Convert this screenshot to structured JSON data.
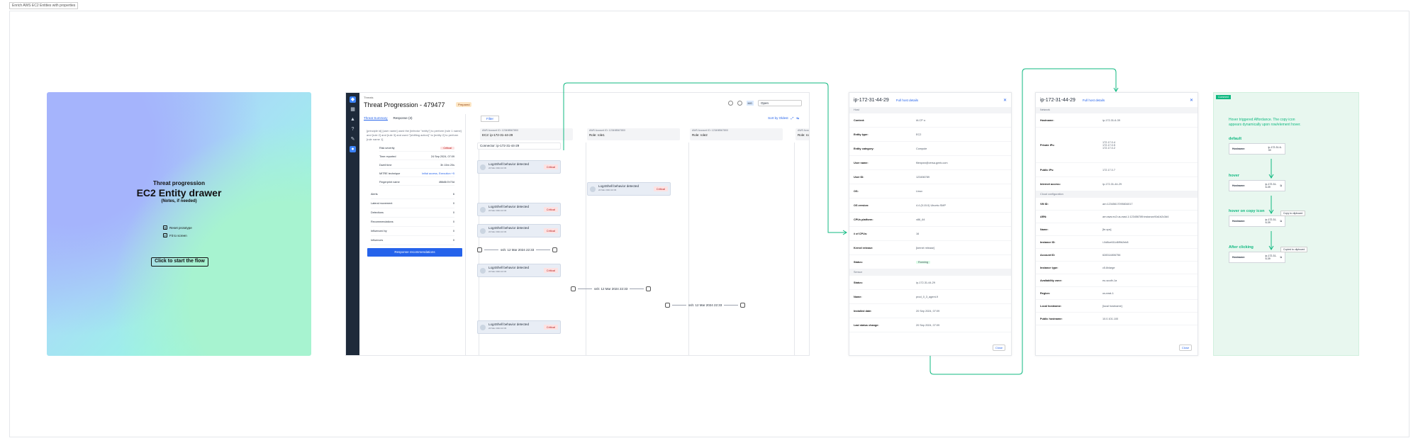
{
  "frame_label": "Enrich AWS EC2 Entities with properties",
  "hero": {
    "title_small": "Threat progression",
    "title_big": "EC2 Entity drawer",
    "title_sub": "(Notes, if needed)",
    "option1": "Reset prototype",
    "option1_key": "R",
    "option2": "Fit to screen",
    "option2_key": "F",
    "start_button": "Click to start the flow"
  },
  "app": {
    "breadcrumb": "Threats",
    "title": "Threat Progression - 479477",
    "status_badge": "Prepared",
    "status_select": "Open",
    "avatar_initials": "MG",
    "tabs": [
      "Threat Summary",
      "Response (3)"
    ],
    "description": "[principle id] [user name] used the [infector \"entity\"] to perform [rule 1 name] and [rule 2] and [rule 3] and used \"[shifting action]\" to [entity 2] to perform [rule name 1]",
    "fields": [
      {
        "k": "Risk severity",
        "v": "Critical",
        "type": "crit"
      },
      {
        "k": "Time reported",
        "v": "24 Sep 2024, 07:09"
      },
      {
        "k": "Dwell time",
        "v": "3h 15m 20s"
      },
      {
        "k": "MITRE technique",
        "v": "Initial access, Execution +5",
        "type": "link"
      },
      {
        "k": "Fingerprint name",
        "v": "4f6b8b7e70d"
      }
    ],
    "counts": [
      {
        "k": "Alerts",
        "v": "6"
      },
      {
        "k": "Lateral movement",
        "v": "0"
      },
      {
        "k": "Detections",
        "v": "0"
      },
      {
        "k": "Recommendations",
        "v": "0"
      },
      {
        "k": "Influenced by",
        "v": "0"
      },
      {
        "k": "Influences",
        "v": "0"
      }
    ],
    "response_button": "Response recommendations",
    "filter_button": "Filter",
    "sort_label": "Sort by Oldest",
    "lanes": [
      {
        "acct": "AWS Account ID: 123498567800",
        "name": "EC2: ip-172-31-44-29"
      },
      {
        "acct": "AWS Account ID: 123498567800",
        "name": "Role: role1"
      },
      {
        "acct": "AWS Account ID: 123498567800",
        "name": "Role: role2"
      },
      {
        "acct": "AWS Account ID: 123498567800",
        "name": "Role: role3"
      }
    ],
    "connector": "Connector: ip-172-31-44-29",
    "event_title": "Log4Shell behavior detected",
    "event_time": "24 Mar 2024 22:33",
    "event_sev": "Critical",
    "switch_label": "ssh: 12 Mar 2024 22:33"
  },
  "drawer1": {
    "title": "ip-172-31-44-29",
    "full_link": "Full host details",
    "close_button": "Close",
    "section1": "Host",
    "rows": [
      {
        "k": "Context:",
        "v": "IA CP ••"
      },
      {
        "k": "Entity type:",
        "v": "EC2"
      },
      {
        "k": "Entity category:",
        "v": "Compute"
      },
      {
        "k": "User name:",
        "v": "filenpwn@versa.geek.com"
      },
      {
        "k": "User ID:",
        "v": "123456789"
      },
      {
        "k": "OS:",
        "v": "Linux"
      },
      {
        "k": "OS version:",
        "v": "4.4 (5.15.0) Ubuntu SMP"
      },
      {
        "k": "CPUs platform:",
        "v": "x86_64"
      },
      {
        "k": "# of CPUs:",
        "v": "16"
      },
      {
        "k": "Kernel release:",
        "v": "[kernel release]"
      },
      {
        "k": "Status:",
        "v": "Running"
      }
    ],
    "section2": "Sensor",
    "rows2": [
      {
        "k": "Status:",
        "v": "ip-172-31-44-29"
      },
      {
        "k": "Name:",
        "v": "prod_0_3_agent-9"
      },
      {
        "k": "Installed date:",
        "v": "20 Sep 2024, 07:09"
      },
      {
        "k": "Last status change:",
        "v": "20 Sep 2024, 07:09"
      }
    ]
  },
  "drawer2": {
    "title": "ip-172-31-44-29",
    "full_link": "Full host details",
    "close_button": "Close",
    "section1": "Network",
    "rows": [
      {
        "k": "Hostname:",
        "v": "ip-172-31-6-39"
      },
      {
        "k": "Private IPs:",
        "v": "172.17.0.4\n172.17.0.5\n172.17.0.2"
      },
      {
        "k": "Public IPs:",
        "v": "172.17.0.7"
      },
      {
        "k": "Internet access:",
        "v": "ip-172-31-44-29"
      }
    ],
    "section2": "Cloud configuration",
    "rows2": [
      {
        "k": "VM ID:",
        "v": "arn:12345617095834017"
      },
      {
        "k": "ARN:",
        "v": "arn:aws:ec2:us-east-1:123456789:instance/i0a1b2c3d4"
      },
      {
        "k": "Name:",
        "v": "[fe.ops]"
      },
      {
        "k": "Instance ID:",
        "v": "i-0d8ce611d6f9b2eb8"
      },
      {
        "k": "Account ID:",
        "v": "628314806756"
      },
      {
        "k": "Instance type:",
        "v": "c5.8xlarge"
      },
      {
        "k": "Availability zone:",
        "v": "eu-south-1a"
      },
      {
        "k": "Region:",
        "v": "us-east-1"
      },
      {
        "k": "Local hostname:",
        "v": "[local hostname]"
      },
      {
        "k": "Public hostname:",
        "v": "10.0.101.100"
      }
    ]
  },
  "notes": {
    "tag": "Comment",
    "intro": "Hover triggered Affordance. The copy icon appears dynamically upon row/element hover.",
    "h1": "default",
    "h2": "hover",
    "h3": "hover on copy icon",
    "h4": "After clicking",
    "card_key": "Hostname:",
    "card_val": "ip-172-31-6-39",
    "tip1": "Copy to clipboard",
    "tip2": "Copied to clipboard"
  },
  "colors": {
    "accent": "#2563eb",
    "flow": "#10b981",
    "critical": "#b91c1c"
  }
}
